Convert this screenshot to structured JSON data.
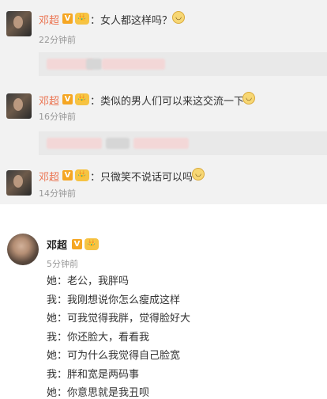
{
  "comments": [
    {
      "name": "邓超",
      "text": "：女人都这样吗？",
      "time": "22分钟前"
    },
    {
      "name": "邓超",
      "text": "：类似的男人们可以来这交流一下",
      "time": "16分钟前"
    },
    {
      "name": "邓超",
      "text": "：只微笑不说话可以吗",
      "time": "14分钟前"
    }
  ],
  "post": {
    "name": "邓超",
    "time": "5分钟前",
    "lines": [
      "她：老公，我胖吗",
      "我：我刚想说你怎么瘦成这样",
      "她：可我觉得我胖，觉得脸好大",
      "我：你还脸大，看看我",
      "她：可为什么我觉得自己脸宽",
      "我：胖和宽是两码事",
      "她：你意思就是我丑呗"
    ]
  },
  "badges": {
    "v": "V",
    "crown": "👑"
  },
  "colors": {
    "name": "#eb7350",
    "time": "#999999",
    "top_bg": "#f2f2f2",
    "badge": "#f5a623"
  },
  "icons": [
    "avatar",
    "verified-badge-icon",
    "membership-crown-icon",
    "smile-emoji-icon"
  ]
}
